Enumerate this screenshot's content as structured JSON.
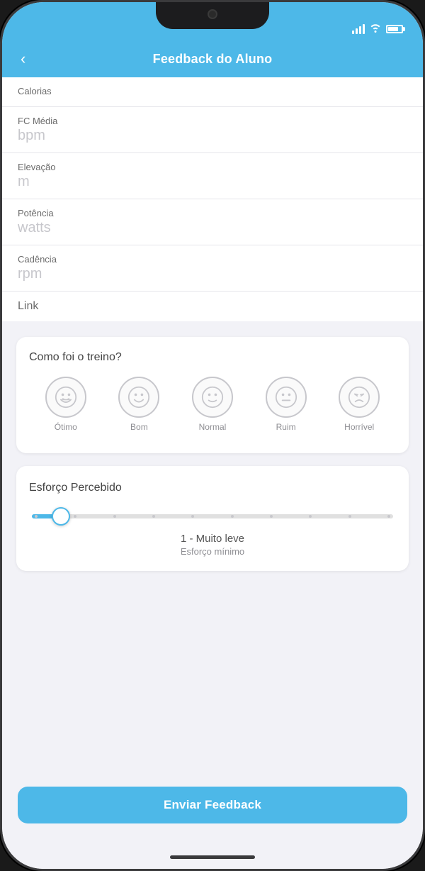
{
  "status": {
    "time": ""
  },
  "header": {
    "back_label": "‹",
    "title": "Feedback do Aluno"
  },
  "fields": [
    {
      "label": "Calorias",
      "value": "",
      "value_placeholder": "",
      "show_value": false
    },
    {
      "label": "FC Média",
      "value": "bpm",
      "show_value": true
    },
    {
      "label": "Elevação",
      "value": "m",
      "show_value": true
    },
    {
      "label": "Potência",
      "value": "watts",
      "show_value": true
    },
    {
      "label": "Cadência",
      "value": "rpm",
      "show_value": true
    },
    {
      "label": "Link",
      "value": "",
      "show_value": false
    }
  ],
  "training_feedback": {
    "title": "Como foi o treino?",
    "options": [
      {
        "emoji_type": "very_happy",
        "label": "Ótimo"
      },
      {
        "emoji_type": "happy",
        "label": "Bom"
      },
      {
        "emoji_type": "neutral_smile",
        "label": "Normal"
      },
      {
        "emoji_type": "neutral",
        "label": "Ruim"
      },
      {
        "emoji_type": "grimace",
        "label": "Horrível"
      }
    ]
  },
  "effort": {
    "title": "Esforço Percebido",
    "slider_value": 1,
    "slider_min": 1,
    "slider_max": 10,
    "level_text": "1 - Muito leve",
    "desc_text": "Esforço mínimo",
    "dots_count": 10
  },
  "submit": {
    "label": "Enviar Feedback"
  }
}
